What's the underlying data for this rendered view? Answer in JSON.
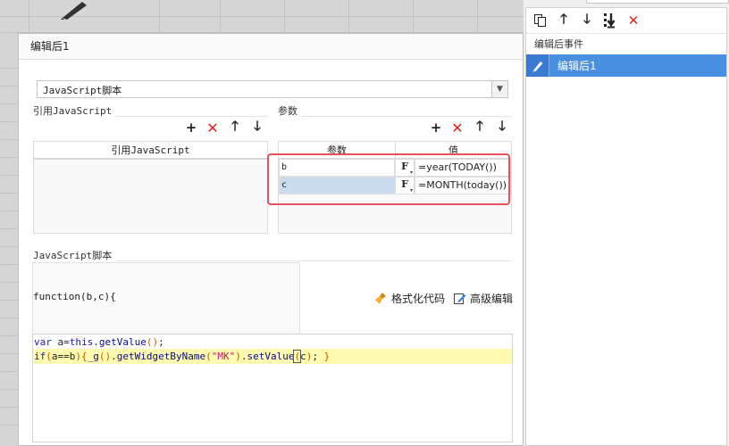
{
  "dialog": {
    "title": "编辑后1",
    "type_select": {
      "value": "JavaScript脚本"
    },
    "ref_group": {
      "label": "引用JavaScript",
      "table_header": "引用JavaScript"
    },
    "param_group": {
      "label": "参数",
      "columns": [
        "参数",
        "值"
      ],
      "rows": [
        {
          "name": "b",
          "fx": "F",
          "value": "=year(TODAY())"
        },
        {
          "name": "c",
          "fx": "F",
          "value": "=MONTH(today())"
        }
      ]
    },
    "script_group": {
      "label": "JavaScript脚本",
      "declaration": "function(b,c){",
      "format_button": "格式化代码",
      "advanced_button": "高级编辑"
    },
    "code": {
      "line1": {
        "kw": "var",
        "a": " a=",
        "this": "this",
        "dot": ".",
        "fn": "getValue",
        "paren": "()",
        "end": ";"
      },
      "line2": {
        "if": "if",
        "p1": "(",
        "cond": "a==b",
        "p2": ")",
        "brace": "{",
        "fn1": "_g",
        "p3": "()",
        "dot1": ".",
        "fn2": "getWidgetByName",
        "p4": "(",
        "str": "\"MK\"",
        "p5": ")",
        "dot2": ".",
        "fn3": "setValue",
        "p6": "(",
        "arg": "c",
        "p7": ")",
        "semi": "; ",
        "close": "}"
      }
    }
  },
  "right_panel": {
    "title": "编辑后事件",
    "events": [
      {
        "label": "编辑后1"
      }
    ]
  },
  "colors": {
    "accent": "#4a90e2",
    "highlight_border": "#e8505b",
    "delete_red": "#e02020"
  },
  "icons": [
    "copy-icon",
    "arrow-up-icon",
    "arrow-down-icon",
    "move-bottom-icon",
    "delete-icon",
    "pencil-icon",
    "plus-icon",
    "broom-icon",
    "edit-doc-icon"
  ]
}
